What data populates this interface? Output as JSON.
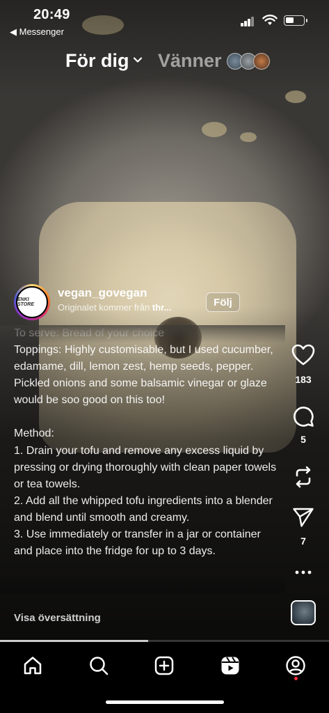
{
  "status_bar": {
    "time": "20:49",
    "back_app": "◀ Messenger"
  },
  "top_tabs": {
    "for_you": "För dig",
    "friends": "Vänner"
  },
  "post": {
    "username": "vegan_govegan",
    "avatar_text": "ENKI STORE",
    "original_prefix": "Originalet kommer från ",
    "original_source": "thr...",
    "follow_label": "Följ",
    "caption_lines": [
      "To serve: Bread of your choice",
      "Toppings: Highly customisable, but I used cucumber, edamame, dill, lemon zest, hemp seeds, pepper. Pickled onions and some balsamic vinegar or glaze would be soo good on this too!",
      "",
      "Method:",
      "1. Drain your tofu and remove any excess liquid by pressing or drying thoroughly with clean paper towels or tea towels.",
      "2. Add all the whipped tofu ingredients into a blender and blend until smooth and creamy.",
      "3. Use immediately or transfer in a jar or container and place into the fridge for up to 3 days."
    ],
    "translate_label": "Visa översättning",
    "progress": 0.45
  },
  "actions": {
    "likes": "183",
    "comments": "5",
    "shares": "7"
  },
  "colors": {
    "notification_dot": "#ff3040",
    "background": "#000000"
  },
  "nav": {
    "items": [
      "home-icon",
      "search-icon",
      "create-icon",
      "reels-icon",
      "profile-icon"
    ]
  }
}
